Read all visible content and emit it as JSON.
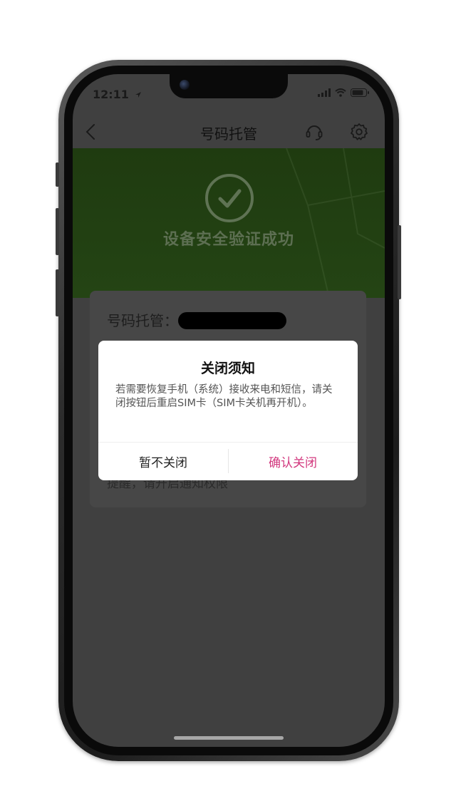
{
  "status_bar": {
    "time": "12:11"
  },
  "nav": {
    "title": "号码托管"
  },
  "banner": {
    "message": "设备安全验证成功"
  },
  "card": {
    "label": "号码托管：",
    "hint": "提醒，请开启通知权限"
  },
  "dialog": {
    "title": "关闭须知",
    "body": "若需要恢复手机（系统）接收来电和短信，请关闭按钮后重启SIM卡（SIM卡关机再开机）。",
    "cancel_label": "暂不关闭",
    "confirm_label": "确认关闭"
  },
  "colors": {
    "accent": "#d2387e",
    "banner_green": "#244414",
    "overlay_gray": "#404040"
  },
  "icons": [
    "back-icon",
    "customer-service-icon",
    "gear-icon",
    "check-circle-icon",
    "signal-icon",
    "wifi-icon",
    "battery-icon",
    "location-arrow-icon"
  ]
}
